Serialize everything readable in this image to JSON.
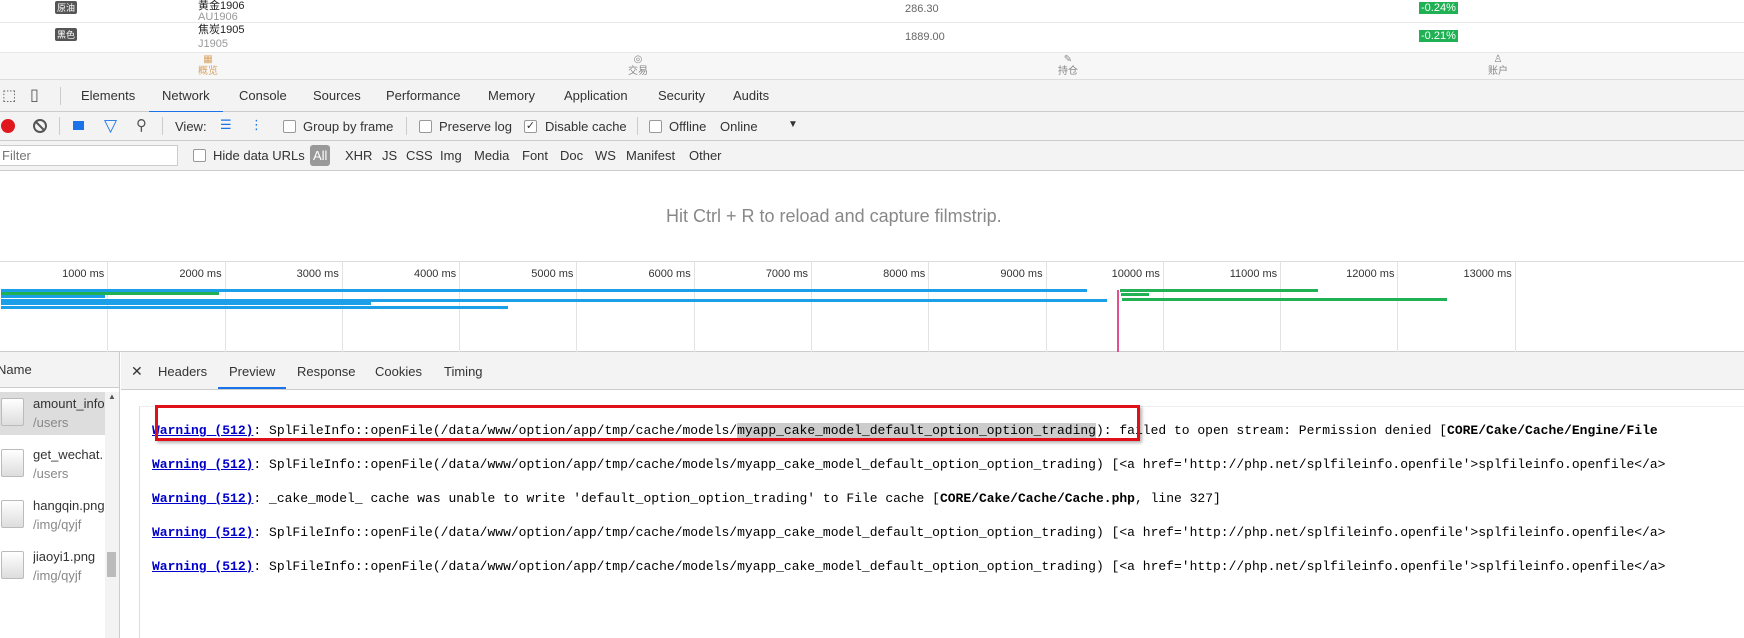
{
  "app": {
    "rows": [
      {
        "tag": "原油",
        "name": "黄金1906",
        "code": "AU1906",
        "price": "286.30",
        "change": "-0.24%"
      },
      {
        "tag": "黑色",
        "name": "焦炭1905",
        "code": "J1905",
        "price": "1889.00",
        "change": "-0.21%"
      }
    ],
    "bottom_nav": [
      {
        "label": "概览",
        "icon": "overview-icon",
        "active": true
      },
      {
        "label": "交易",
        "icon": "trade-icon",
        "active": false
      },
      {
        "label": "持仓",
        "icon": "position-icon",
        "active": false
      },
      {
        "label": "账户",
        "icon": "account-icon",
        "active": false
      }
    ],
    "colors": {
      "up_down_badge": "#1fb153",
      "active_nav": "#d9a35f"
    }
  },
  "devtools": {
    "tabs": [
      "Elements",
      "Network",
      "Console",
      "Sources",
      "Performance",
      "Memory",
      "Application",
      "Security",
      "Audits"
    ],
    "active_tab": "Network",
    "toolbar": {
      "view_label": "View:",
      "group_by_frame": "Group by frame",
      "preserve_log": "Preserve log",
      "disable_cache": "Disable cache",
      "disable_cache_checked": true,
      "offline": "Offline",
      "throttle": "Online"
    },
    "filter": {
      "placeholder": "Filter",
      "hide_data_urls": "Hide data URLs",
      "types": [
        "All",
        "XHR",
        "JS",
        "CSS",
        "Img",
        "Media",
        "Font",
        "Doc",
        "WS",
        "Manifest",
        "Other"
      ],
      "active_type": "All"
    },
    "filmstrip_message": "Hit Ctrl + R to reload and capture filmstrip.",
    "timeline": {
      "ticks": [
        "1000 ms",
        "2000 ms",
        "3000 ms",
        "4000 ms",
        "5000 ms",
        "6000 ms",
        "7000 ms",
        "8000 ms",
        "9000 ms",
        "10000 ms",
        "11000 ms",
        "12000 ms",
        "13000 ms"
      ],
      "bars": [
        {
          "start": 90,
          "end": 9350,
          "color": "#1a9fe8"
        },
        {
          "start": 90,
          "end": 1950,
          "color": "#1fb153"
        },
        {
          "start": 90,
          "end": 980,
          "color": "#1a9fe8"
        },
        {
          "start": 90,
          "end": 9520,
          "color": "#1a9fe8"
        },
        {
          "start": 90,
          "end": 3250,
          "color": "#1a9fe8"
        },
        {
          "start": 90,
          "end": 4420,
          "color": "#1a9fe8"
        },
        {
          "start": 9630,
          "end": 11320,
          "color": "#1fb153"
        },
        {
          "start": 9650,
          "end": 12420,
          "color": "#1fb153"
        },
        {
          "start": 9640,
          "end": 9880,
          "color": "#1fb153"
        }
      ],
      "load_marker_ms": 9610
    },
    "name_header": "Name",
    "files": [
      {
        "name": "amount_info",
        "path": "/users",
        "selected": true
      },
      {
        "name": "get_wechat.",
        "path": "/users",
        "selected": false
      },
      {
        "name": "hangqin.png",
        "path": "/img/qyjf",
        "selected": false
      },
      {
        "name": "jiaoyi1.png",
        "path": "/img/qyjf",
        "selected": false
      }
    ],
    "detail_tabs": [
      "Headers",
      "Preview",
      "Response",
      "Cookies",
      "Timing"
    ],
    "active_detail_tab": "Preview",
    "preview_lines": [
      {
        "link": "Warning (512)",
        "pre": ": SplFileInfo::openFile(/data/www/option/app/tmp/cache/models/",
        "hl": "myapp_cake_model_default_option_option_trading",
        "post": "): failed to open stream: Permission denied [",
        "bold": "CORE/Cake/Cache/Engine/File",
        "tail": ""
      },
      {
        "link": "Warning (512)",
        "pre": ": SplFileInfo::openFile(/data/www/option/app/tmp/cache/models/myapp_cake_model_default_option_option_trading) [<a href='http://php.net/splfileinfo.openfile'>splfileinfo.openfile</a>",
        "hl": "",
        "post": "",
        "bold": "",
        "tail": ""
      },
      {
        "link": "Warning (512)",
        "pre": ": _cake_model_ cache was unable to write 'default_option_option_trading' to File cache [",
        "hl": "",
        "post": "",
        "bold": "CORE/Cake/Cache/Cache.php",
        "tail": ", line 327]"
      },
      {
        "link": "Warning (512)",
        "pre": ": SplFileInfo::openFile(/data/www/option/app/tmp/cache/models/myapp_cake_model_default_option_option_trading) [<a href='http://php.net/splfileinfo.openfile'>splfileinfo.openfile</a>",
        "hl": "",
        "post": "",
        "bold": "",
        "tail": ""
      },
      {
        "link": "Warning (512)",
        "pre": ": SplFileInfo::openFile(/data/www/option/app/tmp/cache/models/myapp_cake_model_default_option_option_trading) [<a href='http://php.net/splfileinfo.openfile'>splfileinfo.openfile</a>",
        "hl": "",
        "post": "",
        "bold": "",
        "tail": ""
      }
    ]
  }
}
